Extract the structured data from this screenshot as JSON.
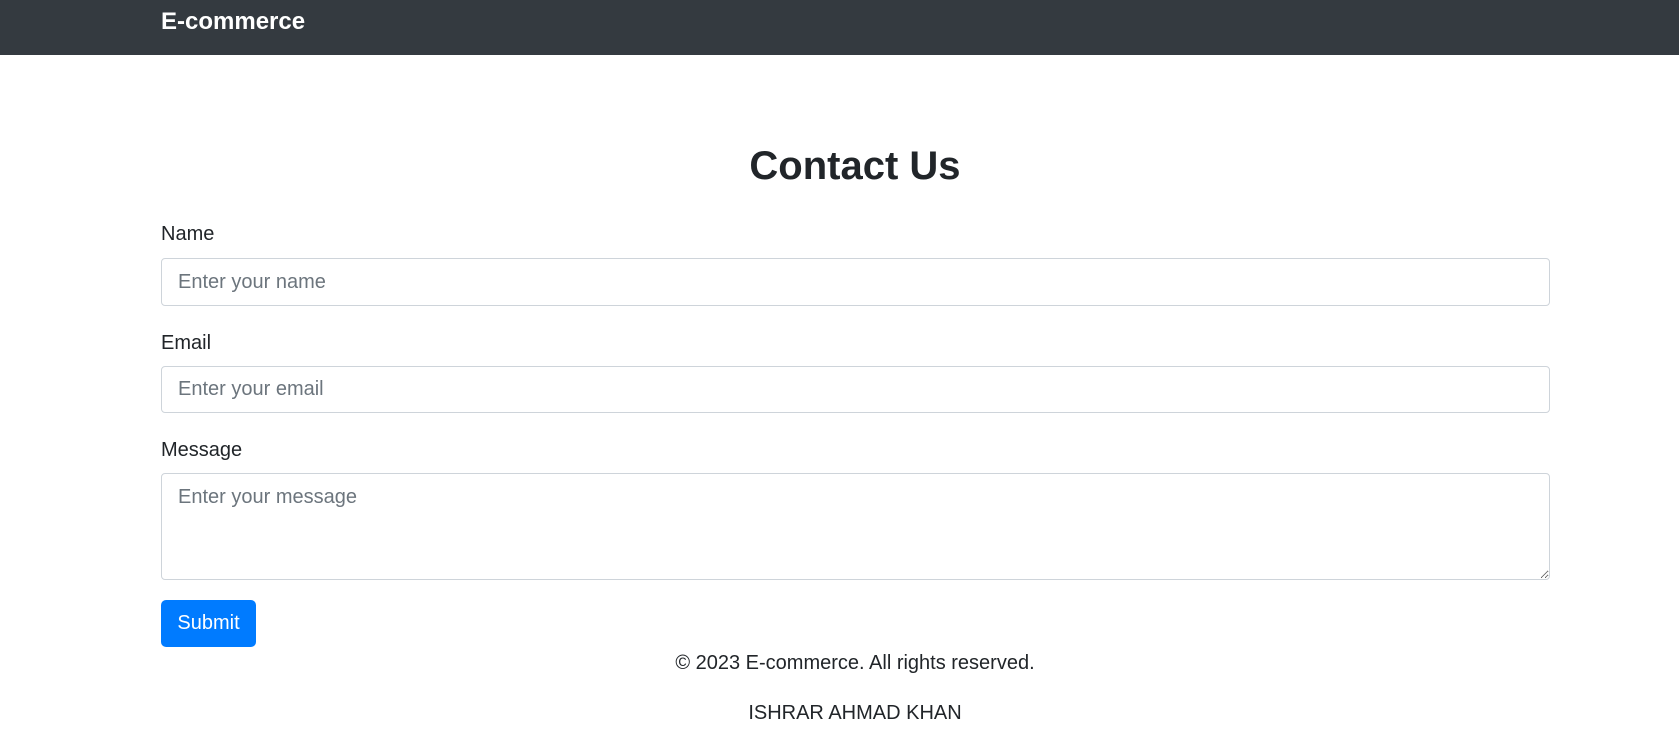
{
  "navbar": {
    "brand": "E-commerce"
  },
  "main": {
    "title": "Contact Us",
    "form": {
      "name_label": "Name",
      "name_placeholder": "Enter your name",
      "email_label": "Email",
      "email_placeholder": "Enter your email",
      "message_label": "Message",
      "message_placeholder": "Enter your message",
      "submit_label": "Submit"
    }
  },
  "footer": {
    "copyright": "© 2023 E-commerce. All rights reserved.",
    "author": "ISHRAR AHMAD KHAN"
  },
  "colors": {
    "navbar_bg": "#343a40",
    "primary": "#007bff"
  }
}
